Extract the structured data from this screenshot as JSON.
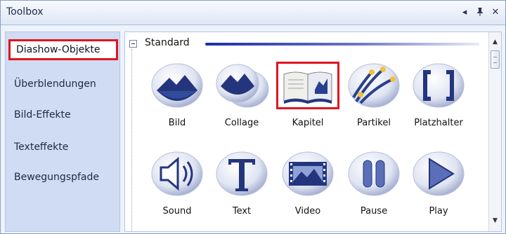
{
  "window": {
    "title": "Toolbox",
    "title_buttons": [
      {
        "name": "dropdown-arrow-icon",
        "glyph": "◂"
      },
      {
        "name": "pin-icon",
        "glyph": "⊥"
      },
      {
        "name": "close-icon",
        "glyph": "✕"
      }
    ]
  },
  "sidebar": {
    "items": [
      {
        "label": "Diashow-Objekte",
        "active": true
      },
      {
        "label": "Überblendungen",
        "active": false
      },
      {
        "label": "Bild-Effekte",
        "active": false
      },
      {
        "label": "Texteffekte",
        "active": false
      },
      {
        "label": "Bewegungspfade",
        "active": false
      }
    ]
  },
  "group": {
    "title": "Standard",
    "expanded": true
  },
  "tiles": [
    {
      "label": "Bild",
      "icon": "image-icon"
    },
    {
      "label": "Collage",
      "icon": "collage-icon"
    },
    {
      "label": "Kapitel",
      "icon": "book-icon",
      "selected": true
    },
    {
      "label": "Partikel",
      "icon": "particle-icon"
    },
    {
      "label": "Platzhalter",
      "icon": "placeholder-icon"
    },
    {
      "label": "Sound",
      "icon": "speaker-icon"
    },
    {
      "label": "Text",
      "icon": "text-icon"
    },
    {
      "label": "Video",
      "icon": "film-icon"
    },
    {
      "label": "Pause",
      "icon": "pause-icon"
    },
    {
      "label": "Play",
      "icon": "play-icon"
    }
  ],
  "colors": {
    "highlight": "#e0141d",
    "sidebar_bg": "#cfdcf3",
    "accent_line": "#1b2cb0",
    "icon_blue": "#2a3f8f"
  }
}
